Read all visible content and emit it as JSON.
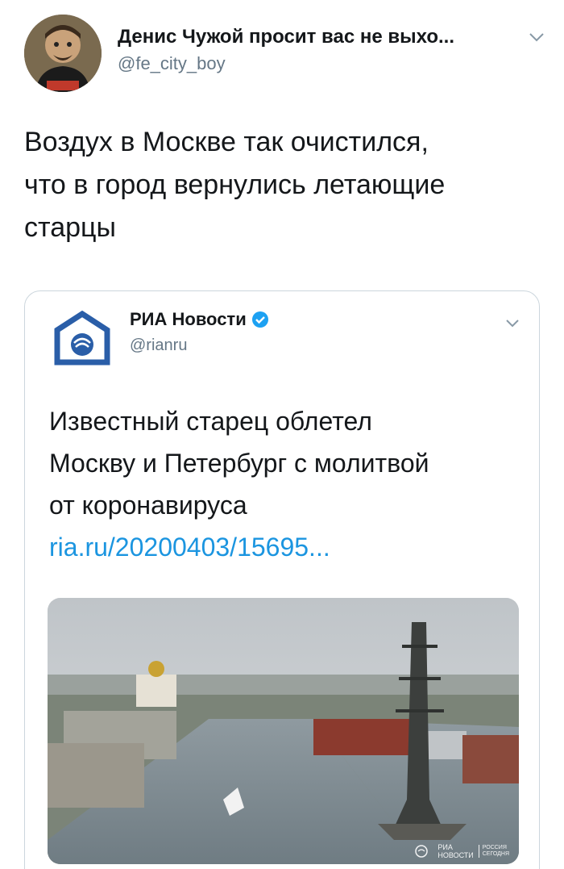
{
  "tweet": {
    "author_name": "Денис Чужой просит вас не выхо...",
    "author_handle": "@fe_city_boy",
    "avatar_icon": "avatar-icon",
    "menu_icon": "chevron-down-icon",
    "text_lines": [
      "Воздух в Москве так очистился,",
      "что в город вернулись летающие",
      "старцы"
    ]
  },
  "quote": {
    "author_name": "РИА Новости",
    "author_handle": "@rianru",
    "verified_icon": "verified-badge-icon",
    "logo_icon": "ria-logo-icon",
    "menu_icon": "chevron-down-icon",
    "text_lines": [
      "Известный старец облетел",
      "Москву и Петербург с молитвой",
      "от коронавируса"
    ],
    "link": "ria.ru/20200403/15695...",
    "media_watermark": [
      "РИА",
      "НОВОСТИ"
    ],
    "media_watermark_side": [
      "РОССИЯ",
      "СЕГОДНЯ"
    ]
  },
  "colors": {
    "link": "#1b95e0",
    "secondary_text": "#657786",
    "verified": "#1da1f2",
    "ria_blue": "#2a5ea8"
  }
}
